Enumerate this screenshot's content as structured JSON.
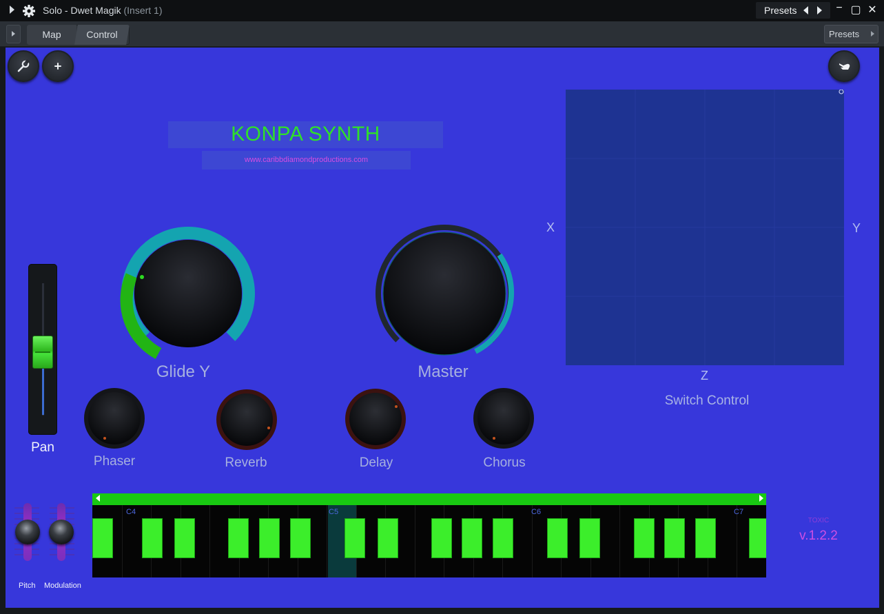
{
  "titlebar": {
    "title": "Solo - Dwet Magik",
    "insert": "(Insert 1)",
    "presets_label": "Presets",
    "minimize_glyph": "−",
    "maximize_glyph": "▢",
    "close_glyph": "✕"
  },
  "toolbar": {
    "tabs": [
      {
        "label": "Map"
      },
      {
        "label": "Control"
      }
    ],
    "active_tab": "Control",
    "presets_button": "Presets"
  },
  "plugin": {
    "title": "KONPA SYNTH",
    "url": "www.caribbdiamondproductions.com",
    "buttons": {
      "left_1_icon": "wrench-icon",
      "left_2_icon": "plus-icon",
      "right_icon": "hand-icon"
    },
    "colors": {
      "background": "#3737db",
      "title_green": "#2fe02a",
      "url_magenta": "#d64ee0",
      "knob_teal": "#14a4b0",
      "knob_green": "#22b414",
      "key_green": "#3cee2b"
    }
  },
  "knobs": {
    "large": [
      {
        "label": "Glide Y"
      },
      {
        "label": "Master"
      }
    ],
    "small": [
      {
        "label": "Phaser"
      },
      {
        "label": "Reverb"
      },
      {
        "label": "Delay"
      },
      {
        "label": "Chorus"
      }
    ]
  },
  "xy_pad": {
    "x_label": "X",
    "y_label": "Y",
    "z_label": "Z",
    "caption": "Switch Control"
  },
  "pan": {
    "label": "Pan"
  },
  "keyboard": {
    "octave_labels": [
      "C4",
      "C5",
      "C6",
      "C7"
    ],
    "highlighted_note": "C5"
  },
  "wheels": {
    "pitch_label": "Pitch",
    "modulation_label": "Modulation"
  },
  "version": {
    "brand": "TOXIC",
    "number": "v.1.2.2"
  }
}
